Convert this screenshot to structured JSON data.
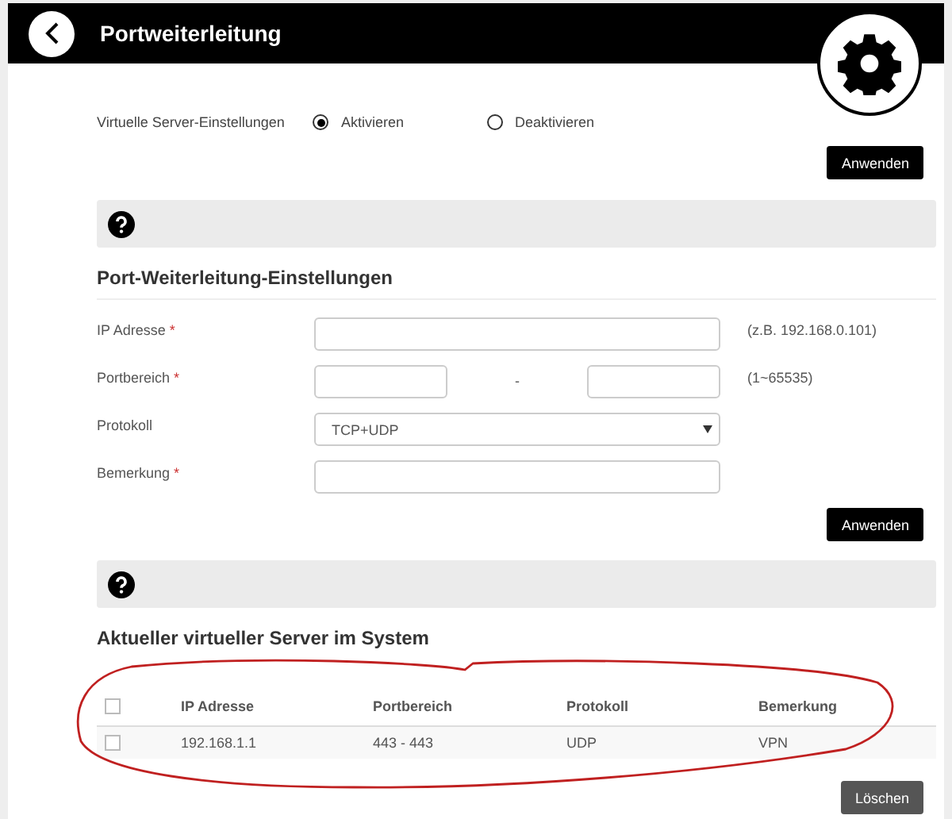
{
  "header": {
    "title": "Portweiterleitung"
  },
  "virtual_server": {
    "label": "Virtuelle Server-Einstellungen",
    "options": [
      {
        "label": "Aktivieren",
        "selected": true
      },
      {
        "label": "Deaktivieren",
        "selected": false
      }
    ],
    "button": "Anwenden"
  },
  "port_forwarding": {
    "title": "Port-Weiterleitung-Einstellungen",
    "fields": [
      {
        "kind": "text",
        "label": "IP Adresse",
        "required": "*",
        "hint": "(z.B. 192.168.0.101)"
      },
      {
        "kind": "range",
        "label": "Portbereich",
        "required": "*",
        "separator": "-",
        "hint": "(1~65535)"
      },
      {
        "kind": "select",
        "label": "Protokoll",
        "value": "TCP+UDP"
      },
      {
        "kind": "text",
        "label": "Bemerkung",
        "required": "*"
      }
    ],
    "button": "Anwenden"
  },
  "server_table": {
    "title": "Aktueller virtueller Server im System",
    "columns": [
      "IP Adresse",
      "Portbereich",
      "Protokoll",
      "Bemerkung"
    ],
    "header_checked": false,
    "rows": [
      {
        "checked": false,
        "cells": [
          "192.168.1.1",
          "443 - 443",
          "UDP",
          "VPN"
        ]
      }
    ],
    "button": "Löschen"
  },
  "annotation": {
    "kind": "ellipse"
  }
}
